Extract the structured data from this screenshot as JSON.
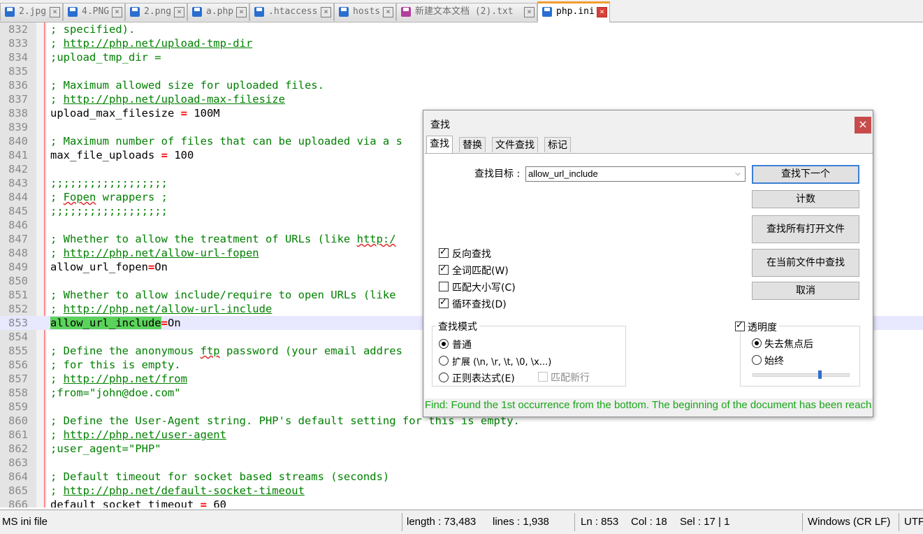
{
  "tabs": [
    {
      "label": "2.jpg",
      "active": false,
      "modified": false
    },
    {
      "label": "4.PNG",
      "active": false,
      "modified": false
    },
    {
      "label": "2.png",
      "active": false,
      "modified": false
    },
    {
      "label": "a.php",
      "active": false,
      "modified": false
    },
    {
      "label": ".htaccess",
      "active": false,
      "modified": false
    },
    {
      "label": "hosts",
      "active": false,
      "modified": false
    },
    {
      "label": "新建文本文档 (2).txt",
      "active": false,
      "modified": true
    },
    {
      "label": "php.ini",
      "active": true,
      "modified": false
    }
  ],
  "editor": {
    "lines": [
      {
        "num": "832",
        "text": "; specified)."
      },
      {
        "num": "833",
        "text": "; http://php.net/upload-tmp-dir"
      },
      {
        "num": "834",
        "text": ";upload_tmp_dir ="
      },
      {
        "num": "835",
        "text": ""
      },
      {
        "num": "836",
        "text": "; Maximum allowed size for uploaded files."
      },
      {
        "num": "837",
        "text": "; http://php.net/upload-max-filesize"
      },
      {
        "num": "838",
        "text": "upload_max_filesize = 100M"
      },
      {
        "num": "839",
        "text": ""
      },
      {
        "num": "840",
        "text": "; Maximum number of files that can be uploaded via a s"
      },
      {
        "num": "841",
        "text": "max_file_uploads = 100"
      },
      {
        "num": "842",
        "text": ""
      },
      {
        "num": "843",
        "text": ";;;;;;;;;;;;;;;;;;"
      },
      {
        "num": "844",
        "text": "; Fopen wrappers ;"
      },
      {
        "num": "845",
        "text": ";;;;;;;;;;;;;;;;;;"
      },
      {
        "num": "846",
        "text": ""
      },
      {
        "num": "847",
        "text": "; Whether to allow the treatment of URLs (like http:/"
      },
      {
        "num": "848",
        "text": "; http://php.net/allow-url-fopen"
      },
      {
        "num": "849",
        "text": "allow_url_fopen=On"
      },
      {
        "num": "850",
        "text": ""
      },
      {
        "num": "851",
        "text": "; Whether to allow include/require to open URLs (like"
      },
      {
        "num": "852",
        "text": "; http://php.net/allow-url-include"
      },
      {
        "num": "853",
        "text": "allow_url_include=On"
      },
      {
        "num": "854",
        "text": ""
      },
      {
        "num": "855",
        "text": "; Define the anonymous ftp password (your email addres"
      },
      {
        "num": "856",
        "text": "; for this is empty."
      },
      {
        "num": "857",
        "text": "; http://php.net/from"
      },
      {
        "num": "858",
        "text": ";from=\"john@doe.com\""
      },
      {
        "num": "859",
        "text": ""
      },
      {
        "num": "860",
        "text": "; Define the User-Agent string. PHP's default setting for this is empty."
      },
      {
        "num": "861",
        "text": "; http://php.net/user-agent"
      },
      {
        "num": "862",
        "text": ";user_agent=\"PHP\""
      },
      {
        "num": "863",
        "text": ""
      },
      {
        "num": "864",
        "text": "; Default timeout for socket based streams (seconds)"
      },
      {
        "num": "865",
        "text": "; http://php.net/default-socket-timeout"
      },
      {
        "num": "866",
        "text": "default_socket_timeout = 60"
      }
    ]
  },
  "status": {
    "file_type": "MS ini file",
    "length": "length : 73,483",
    "lines": "lines : 1,938",
    "ln": "Ln : 853",
    "col": "Col : 18",
    "sel": "Sel : 17 | 1",
    "eol": "Windows (CR LF)",
    "encoding": "UTF"
  },
  "find_dialog": {
    "title": "查找",
    "close": "×",
    "tabs": [
      "查找",
      "替换",
      "文件查找",
      "标记"
    ],
    "target_label": "查找目标 :",
    "target_value": "allow_url_include",
    "buttons": {
      "find_next": "查找下一个",
      "count": "计数",
      "find_all_open": "查找所有打开文件",
      "find_in_current": "在当前文件中查找",
      "cancel": "取消"
    },
    "options": {
      "backward": {
        "label": "反向查找",
        "checked": true
      },
      "whole_word": {
        "label": "全词匹配(W)",
        "checked": true
      },
      "match_case": {
        "label": "匹配大小写(C)",
        "checked": false
      },
      "wrap": {
        "label": "循环查找(D)",
        "checked": true
      }
    },
    "search_mode": {
      "title": "查找模式",
      "normal": "普通",
      "extended": "扩展 (\\n, \\r, \\t, \\0, \\x...)",
      "regex": "正则表达式(E)",
      "match_newline": "匹配新行",
      "selected": "normal"
    },
    "transparency": {
      "title": "透明度",
      "checked": true,
      "on_lose_focus": "失去焦点后",
      "always": "始终",
      "selected": "on_lose_focus",
      "level": 0.7
    },
    "message": "Find: Found the 1st occurrence from the bottom. The beginning of the document has been reached."
  }
}
